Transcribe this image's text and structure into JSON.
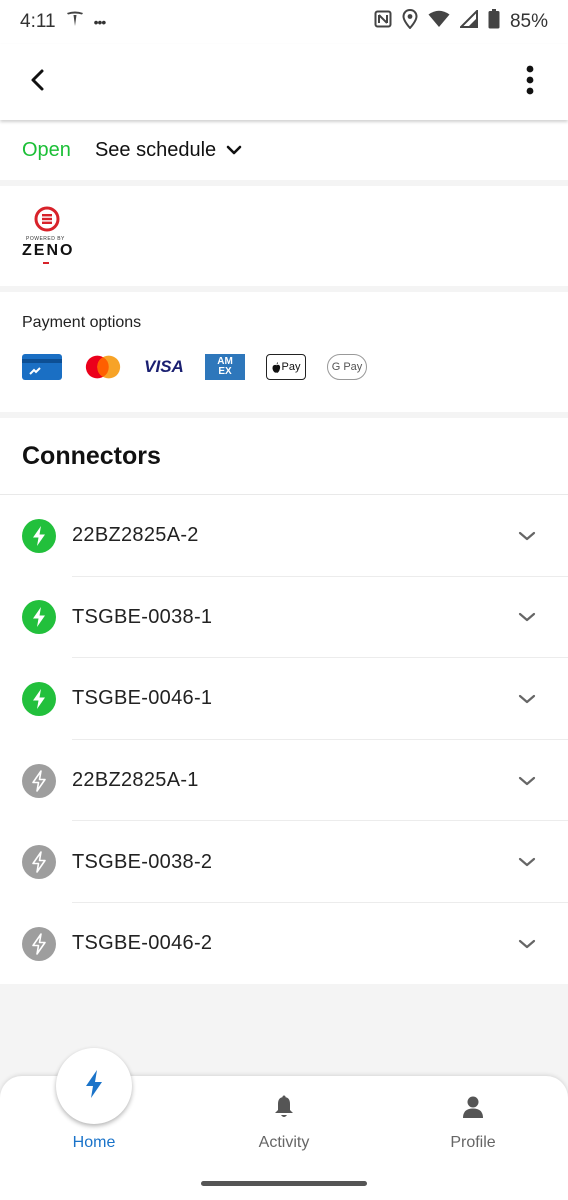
{
  "status_bar": {
    "time": "4:11",
    "dots": "•••",
    "battery": "85%",
    "icons": [
      "tesla-icon",
      "nfc-icon",
      "location-icon",
      "wifi-icon",
      "signal-icon",
      "battery-icon"
    ]
  },
  "app_bar": {
    "back_icon": "arrow-back-icon",
    "more_icon": "more-vert-icon"
  },
  "hours": {
    "status": "Open",
    "schedule_label": "See schedule"
  },
  "operator": {
    "powered_by": "POWERED BY",
    "brand": "ZENO"
  },
  "payment": {
    "title": "Payment options",
    "methods": [
      "card",
      "mastercard",
      "visa",
      "amex",
      "apple-pay",
      "google-pay"
    ],
    "visa_label": "VISA",
    "amex_label": "AM EX",
    "applepay_label": "Pay",
    "gpay_label": "G Pay"
  },
  "connectors": {
    "title": "Connectors",
    "items": [
      {
        "id": "22BZ2825A-2",
        "status": "available"
      },
      {
        "id": "TSGBE-0038-1",
        "status": "available"
      },
      {
        "id": "TSGBE-0046-1",
        "status": "available"
      },
      {
        "id": "22BZ2825A-1",
        "status": "unavailable"
      },
      {
        "id": "TSGBE-0038-2",
        "status": "unavailable"
      },
      {
        "id": "TSGBE-0046-2",
        "status": "unavailable"
      }
    ]
  },
  "bottom_nav": {
    "items": [
      {
        "label": "Home",
        "icon": "bolt-icon",
        "active": true
      },
      {
        "label": "Activity",
        "icon": "bell-icon",
        "active": false
      },
      {
        "label": "Profile",
        "icon": "person-icon",
        "active": false
      }
    ]
  },
  "colors": {
    "available": "#22c03c",
    "unavailable": "#9e9e9e",
    "open": "#1bbf36",
    "accent": "#1a73c9"
  }
}
